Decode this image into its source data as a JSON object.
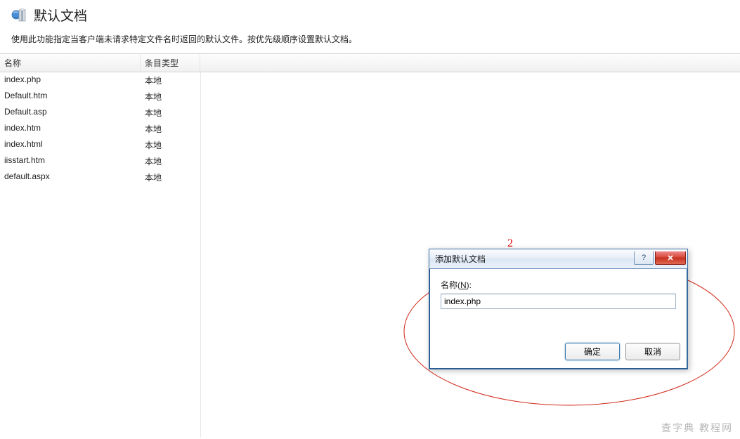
{
  "header": {
    "title": "默认文档"
  },
  "description": "使用此功能指定当客户端未请求特定文件名时返回的默认文件。按优先级顺序设置默认文档。",
  "table": {
    "columns": {
      "name": "名称",
      "type": "条目类型"
    },
    "rows": [
      {
        "name": "index.php",
        "type": "本地"
      },
      {
        "name": "Default.htm",
        "type": "本地"
      },
      {
        "name": "Default.asp",
        "type": "本地"
      },
      {
        "name": "index.htm",
        "type": "本地"
      },
      {
        "name": "index.html",
        "type": "本地"
      },
      {
        "name": "iisstart.htm",
        "type": "本地"
      },
      {
        "name": "default.aspx",
        "type": "本地"
      }
    ]
  },
  "annotation": {
    "step": "2"
  },
  "dialog": {
    "title": "添加默认文档",
    "field_label_pre": "名称(",
    "field_hotkey": "N",
    "field_label_post": "):",
    "input_value": "index.php",
    "ok_label": "确定",
    "cancel_label": "取消"
  },
  "watermark": "查字典 教程网"
}
